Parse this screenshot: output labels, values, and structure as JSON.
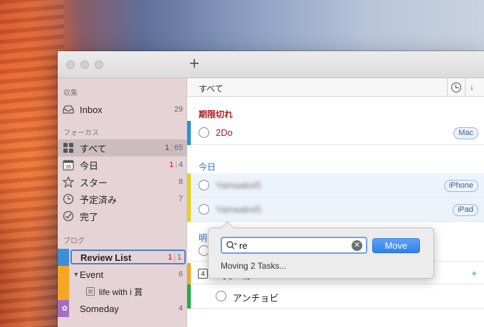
{
  "sidebar": {
    "sections": {
      "collect": "収集",
      "focus": "フォーカス",
      "blog": "ブログ"
    },
    "items": [
      {
        "label": "Inbox",
        "count": "29"
      },
      {
        "label": "すべて",
        "count_red": "1",
        "count": "65"
      },
      {
        "label": "今日",
        "count_red": "1",
        "count": "4",
        "day": "26"
      },
      {
        "label": "スター",
        "count": "8"
      },
      {
        "label": "予定済み",
        "count": "7"
      },
      {
        "label": "完了",
        "count": ""
      },
      {
        "label": "Review List",
        "count_red": "1",
        "count": "1"
      },
      {
        "label": "Event",
        "count": "6"
      },
      {
        "label": "life with i 賞",
        "count": ""
      },
      {
        "label": "Someday",
        "count": "4"
      }
    ]
  },
  "main": {
    "header_title": "すべて",
    "groups": {
      "overdue": "期限切れ",
      "today": "今日",
      "tomorrow": "明",
      "shopping": "買い物"
    },
    "tasks": [
      {
        "text": "2Do",
        "tag": "Mac"
      },
      {
        "text": "Yamaakoi5",
        "tag": "iPhone"
      },
      {
        "text": "Yamaakoi5",
        "tag": "iPad"
      },
      {
        "text": "アンチョビ",
        "tag": ""
      }
    ],
    "shopping_day": "4"
  },
  "popover": {
    "search_value": "re",
    "move_label": "Move",
    "status": "Moving 2 Tasks..."
  },
  "colors": {
    "overdue_red": "#b0161b",
    "today_blue": "#2a6fc9",
    "accent_blue": "#2f7ff0"
  }
}
